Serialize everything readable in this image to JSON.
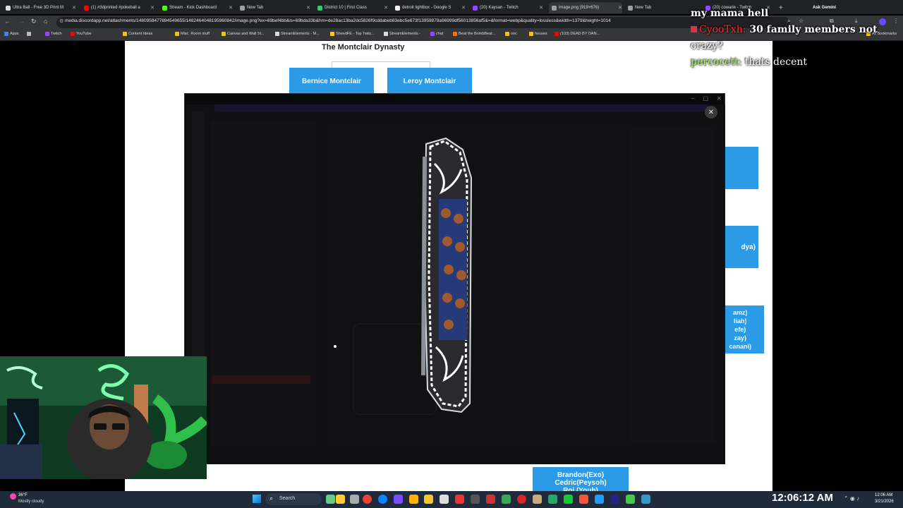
{
  "browser": {
    "tabs": [
      {
        "label": "Ultra Ball - Free 3D Print M",
        "color": "#e0e0e0"
      },
      {
        "label": "(1) #3dprinted #pokeball a",
        "color": "#ff0000"
      },
      {
        "label": "Stream - Kick Dashboard",
        "color": "#53fc18"
      },
      {
        "label": "New Tab",
        "color": "#9aa0a6"
      },
      {
        "label": "District 10 | First Class",
        "color": "#2ecc71"
      },
      {
        "label": "detroit lightbox - Google S",
        "color": "#ffffff"
      },
      {
        "label": "(20) Kaysan - Twitch",
        "color": "#9146ff"
      },
      {
        "label": "image.png (919×676)",
        "color": "#9aa0a6"
      },
      {
        "label": "New Tab",
        "color": "#9aa0a6"
      },
      {
        "label": "(20) cowarie - Twitch",
        "color": "#9146ff"
      }
    ],
    "ask_gemini": "Ask Gemini",
    "url": "media.discordapp.net/attachments/1480958477894549655/1482464048195960842/image.png?ex=69bef4bb&is=69bda33b&hm=de28ac13ba2dc5826f9cddabeb83ebc5e673f13959879a96999df56013856af5&=&format=webp&quality=lossless&width=1379&height=1014",
    "bookmarks": [
      {
        "label": "Apps",
        "color": "#4285f4"
      },
      {
        "label": "Twitch",
        "color": "#9146ff"
      },
      {
        "label": "YouTube",
        "color": "#ff0000"
      },
      {
        "label": "Content Ideas",
        "color": "#f1c40f"
      },
      {
        "label": "Misc. Room stuff",
        "color": "#f1c40f"
      },
      {
        "label": "Canvas and Wall St...",
        "color": "#f1c40f"
      },
      {
        "label": "StreamElements - M...",
        "color": "#ffffff"
      },
      {
        "label": "SheedFE - Top Twitc...",
        "color": "#ffcc00"
      },
      {
        "label": "StreamElements -",
        "color": "#ffffff"
      },
      {
        "label": "chat",
        "color": "#9146ff"
      },
      {
        "label": "Beat the BombBeat...",
        "color": "#ff6f00"
      },
      {
        "label": "ooc",
        "color": "#f1c40f"
      },
      {
        "label": "houses",
        "color": "#f1c40f"
      },
      {
        "label": "(103) DEAD BY DAN...",
        "color": "#ff0000"
      }
    ],
    "all_bookmarks": "All Bookmarks"
  },
  "page": {
    "title": "The Montclair Dynasty",
    "boxes": [
      {
        "label": "Bernice Montclair"
      },
      {
        "label": "Leroy Montclair"
      },
      {
        "label": "dya)"
      },
      {
        "label": "amz)\nliah)\nefe)\nzay)\ncanani)"
      },
      {
        "label": "Brandon(Exo)\nCedric(Peysoh)\nRoi (Youh)"
      }
    ]
  },
  "chat": [
    {
      "user": "",
      "message": "my mama hell",
      "user_color": "#ffffff"
    },
    {
      "user": "CyooTxh:",
      "message": "30 family members not",
      "user_color": "#ff2b2b"
    },
    {
      "user": "",
      "message": "crazy?",
      "user_color": "#ffffff"
    },
    {
      "user": "percocett:",
      "message": "thats decent",
      "user_color": "#9fff4a"
    }
  ],
  "taskbar": {
    "weather_temp": "36°F",
    "weather_desc": "Mostly cloudy",
    "search_label": "Search",
    "clock": "12:06:12 AM",
    "tray_time": "12:06 AM",
    "tray_date": "3/21/2026"
  },
  "colors": {
    "accent_blue": "#2b9be8",
    "taskbar_bg": "#1f2b3a"
  }
}
